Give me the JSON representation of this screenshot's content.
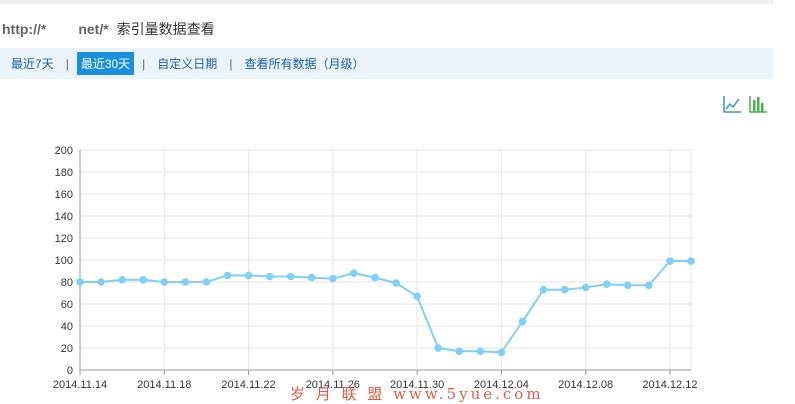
{
  "header": {
    "site_prefix": "http://*",
    "site_suffix": "net/*",
    "title": "索引量数据查看"
  },
  "nav": {
    "items": [
      {
        "label": "最近7天",
        "active": false
      },
      {
        "label": "最近30天",
        "active": true
      },
      {
        "label": "自定义日期",
        "active": false
      },
      {
        "label": "查看所有数据（月级）",
        "active": false
      }
    ],
    "separator": "|"
  },
  "toolbar": {
    "line_icon": "line-chart-icon",
    "bar_icon": "bar-chart-icon"
  },
  "watermark": "岁 月 联 盟  www.5yue.com",
  "colors": {
    "accent": "#1a8fdf",
    "series": "#7fd0f4",
    "nav_bg": "#ebf3fb",
    "link": "#1b5fa3",
    "icon_line": "#3a93d8",
    "icon_bar": "#4caf50"
  },
  "chart_data": {
    "type": "line",
    "x": [
      "2014.11.14",
      "2014.11.15",
      "2014.11.16",
      "2014.11.17",
      "2014.11.18",
      "2014.11.19",
      "2014.11.20",
      "2014.11.21",
      "2014.11.22",
      "2014.11.23",
      "2014.11.24",
      "2014.11.25",
      "2014.11.26",
      "2014.11.27",
      "2014.11.28",
      "2014.11.29",
      "2014.11.30",
      "2014.12.01",
      "2014.12.02",
      "2014.12.03",
      "2014.12.04",
      "2014.12.05",
      "2014.12.06",
      "2014.12.07",
      "2014.12.08",
      "2014.12.09",
      "2014.12.10",
      "2014.12.11",
      "2014.12.12",
      "2014.12.13"
    ],
    "series": [
      {
        "values": [
          80,
          80,
          82,
          82,
          80,
          80,
          80,
          86,
          86,
          85,
          85,
          84,
          83,
          88,
          84,
          79,
          67,
          20,
          17,
          17,
          16,
          44,
          73,
          73,
          75,
          78,
          77,
          77,
          99,
          99
        ]
      }
    ],
    "xticks": [
      "2014.11.14",
      "2014.11.18",
      "2014.11.22",
      "2014.11.26",
      "2014.11.30",
      "2014.12.04",
      "2014.12.08",
      "2014.12.12"
    ],
    "yticks": [
      0,
      20,
      40,
      60,
      80,
      100,
      120,
      140,
      160,
      180,
      200
    ],
    "ylim": [
      0,
      200
    ],
    "grid": true
  }
}
